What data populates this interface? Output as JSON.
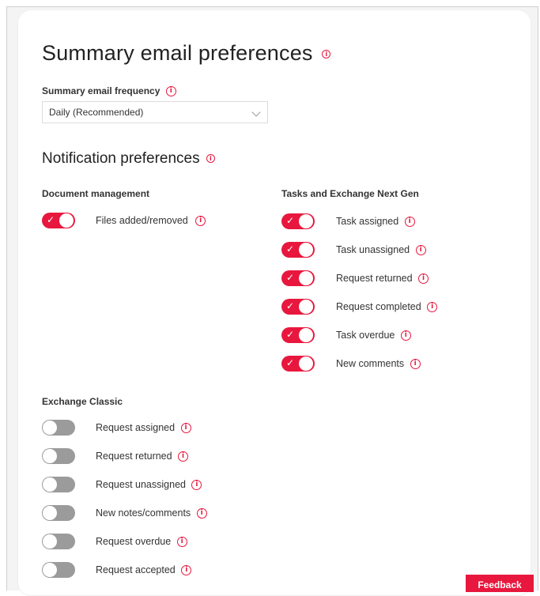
{
  "summary": {
    "title": "Summary email preferences",
    "frequency_label": "Summary email frequency",
    "frequency_value": "Daily (Recommended)"
  },
  "notifications": {
    "title": "Notification preferences",
    "document_management": {
      "heading": "Document management",
      "items": [
        {
          "label": "Files added/removed",
          "on": true
        }
      ]
    },
    "tasks_exchange": {
      "heading": "Tasks and Exchange Next Gen",
      "items": [
        {
          "label": "Task assigned",
          "on": true
        },
        {
          "label": "Task unassigned",
          "on": true
        },
        {
          "label": "Request returned",
          "on": true
        },
        {
          "label": "Request completed",
          "on": true
        },
        {
          "label": "Task overdue",
          "on": true
        },
        {
          "label": "New comments",
          "on": true
        }
      ]
    },
    "exchange_classic": {
      "heading": "Exchange Classic",
      "items": [
        {
          "label": "Request assigned",
          "on": false
        },
        {
          "label": "Request returned",
          "on": false
        },
        {
          "label": "Request unassigned",
          "on": false
        },
        {
          "label": "New notes/comments",
          "on": false
        },
        {
          "label": "Request overdue",
          "on": false
        },
        {
          "label": "Request accepted",
          "on": false
        }
      ]
    }
  },
  "feedback_label": "Feedback",
  "icons": {
    "info": "info-icon",
    "check": "check-icon",
    "chevron": "chevron-down-icon"
  },
  "colors": {
    "accent": "#e8173e",
    "toggle_off": "#9b9b9b"
  }
}
